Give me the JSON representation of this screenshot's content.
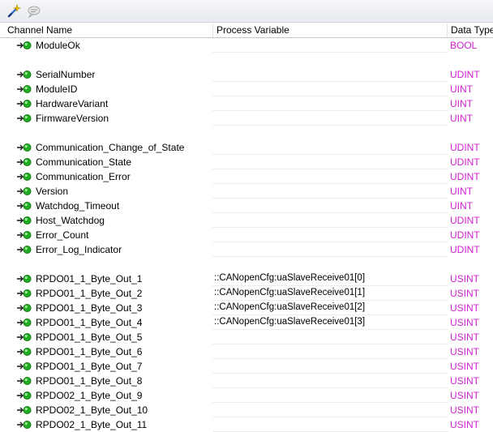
{
  "header": {
    "channel_name": "Channel Name",
    "process_variable": "Process Variable",
    "data_type": "Data Type"
  },
  "rows": [
    {
      "name": "ModuleOk",
      "pv": "",
      "type": "BOOL"
    },
    null,
    {
      "name": "SerialNumber",
      "pv": "",
      "type": "UDINT"
    },
    {
      "name": "ModuleID",
      "pv": "",
      "type": "UINT"
    },
    {
      "name": "HardwareVariant",
      "pv": "",
      "type": "UINT"
    },
    {
      "name": "FirmwareVersion",
      "pv": "",
      "type": "UINT"
    },
    null,
    {
      "name": "Communication_Change_of_State",
      "pv": "",
      "type": "UDINT"
    },
    {
      "name": "Communication_State",
      "pv": "",
      "type": "UDINT"
    },
    {
      "name": "Communication_Error",
      "pv": "",
      "type": "UDINT"
    },
    {
      "name": "Version",
      "pv": "",
      "type": "UINT"
    },
    {
      "name": "Watchdog_Timeout",
      "pv": "",
      "type": "UINT"
    },
    {
      "name": "Host_Watchdog",
      "pv": "",
      "type": "UDINT"
    },
    {
      "name": "Error_Count",
      "pv": "",
      "type": "UDINT"
    },
    {
      "name": "Error_Log_Indicator",
      "pv": "",
      "type": "UDINT"
    },
    null,
    {
      "name": "RPDO01_1_Byte_Out_1",
      "pv": "::CANopenCfg:uaSlaveReceive01[0]",
      "type": "USINT"
    },
    {
      "name": "RPDO01_1_Byte_Out_2",
      "pv": "::CANopenCfg:uaSlaveReceive01[1]",
      "type": "USINT"
    },
    {
      "name": "RPDO01_1_Byte_Out_3",
      "pv": "::CANopenCfg:uaSlaveReceive01[2]",
      "type": "USINT"
    },
    {
      "name": "RPDO01_1_Byte_Out_4",
      "pv": "::CANopenCfg:uaSlaveReceive01[3]",
      "type": "USINT"
    },
    {
      "name": "RPDO01_1_Byte_Out_5",
      "pv": "",
      "type": "USINT"
    },
    {
      "name": "RPDO01_1_Byte_Out_6",
      "pv": "",
      "type": "USINT"
    },
    {
      "name": "RPDO01_1_Byte_Out_7",
      "pv": "",
      "type": "USINT"
    },
    {
      "name": "RPDO01_1_Byte_Out_8",
      "pv": "",
      "type": "USINT"
    },
    {
      "name": "RPDO02_1_Byte_Out_9",
      "pv": "",
      "type": "USINT"
    },
    {
      "name": "RPDO02_1_Byte_Out_10",
      "pv": "",
      "type": "USINT"
    },
    {
      "name": "RPDO02_1_Byte_Out_11",
      "pv": "",
      "type": "USINT"
    }
  ],
  "icons": {
    "toolbar_1": "wand-icon",
    "toolbar_2": "comment-icon",
    "channel": "io-channel-icon"
  },
  "colors": {
    "data_type": "#d020d0",
    "io_dot": "#22aa22"
  }
}
